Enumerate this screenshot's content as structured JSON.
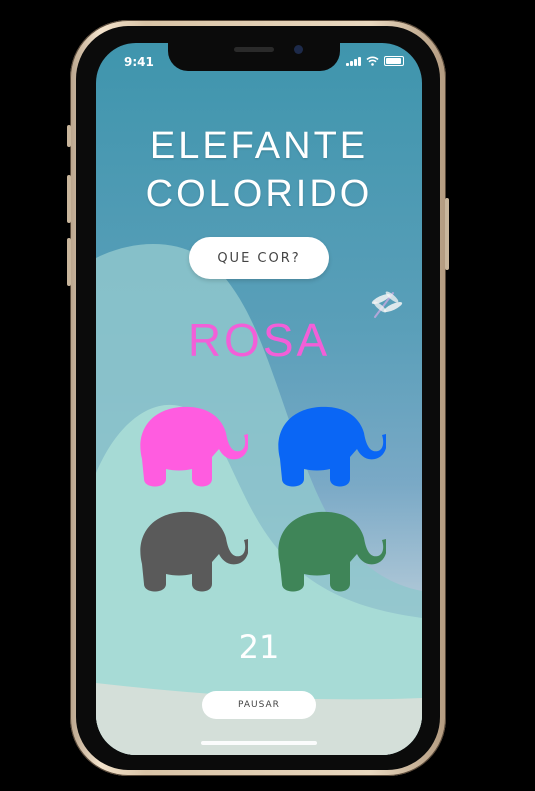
{
  "status_bar": {
    "time": "9:41"
  },
  "title": {
    "line1": "ELEFANTE",
    "line2": "COLORIDO"
  },
  "question_button": "QUE COR?",
  "target_color_word": "ROSA",
  "target_color_hex": "#f25fd8",
  "elephants": [
    {
      "color_name": "pink",
      "hex": "#ff5ce0"
    },
    {
      "color_name": "blue",
      "hex": "#0a66f5"
    },
    {
      "color_name": "gray",
      "hex": "#5a5a5a"
    },
    {
      "color_name": "green",
      "hex": "#3f8558"
    }
  ],
  "counter": "21",
  "pause_button": "PAUSAR"
}
